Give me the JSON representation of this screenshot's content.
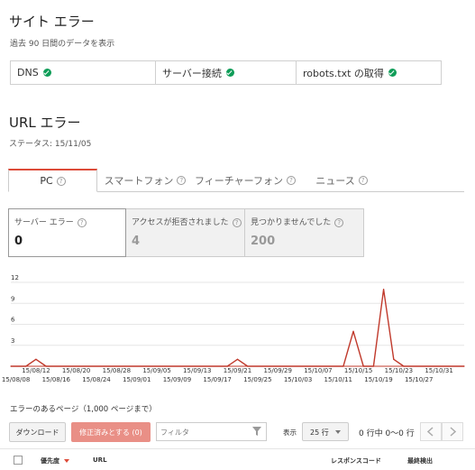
{
  "site_errors": {
    "title": "サイト エラー",
    "subtitle": "過去 90 日間のデータを表示",
    "items": [
      {
        "label": "DNS",
        "status": "ok"
      },
      {
        "label": "サーバー接続",
        "status": "ok"
      },
      {
        "label": "robots.txt の取得",
        "status": "ok"
      }
    ]
  },
  "url_errors": {
    "title": "URL エラー",
    "status": "ステータス: 15/11/05"
  },
  "tabs": [
    {
      "label": "PC",
      "active": true
    },
    {
      "label": "スマートフォン",
      "active": false
    },
    {
      "label": "フィーチャーフォン",
      "active": false
    },
    {
      "label": "ニュース",
      "active": false
    }
  ],
  "cards": [
    {
      "label": "サーバー エラー",
      "value": "0",
      "active": true
    },
    {
      "label": "アクセスが拒否されました",
      "value": "4",
      "active": false
    },
    {
      "label": "見つかりませんでした",
      "value": "200",
      "active": false
    }
  ],
  "chart_data": {
    "type": "line",
    "y_ticks": [
      "12",
      "9",
      "6",
      "3"
    ],
    "ylim": [
      0,
      12
    ],
    "x_ticks_top": [
      "15/08/12",
      "15/08/20",
      "15/08/28",
      "15/09/05",
      "15/09/13",
      "15/09/21",
      "15/09/29",
      "15/10/07",
      "15/10/15",
      "15/10/23",
      "15/10/31"
    ],
    "x_ticks_bottom": [
      "15/08/08",
      "15/08/16",
      "15/08/24",
      "15/09/01",
      "15/09/09",
      "15/09/17",
      "15/09/25",
      "15/10/03",
      "15/10/11",
      "15/10/19",
      "15/10/27"
    ],
    "series": [
      {
        "color": "#c0392b",
        "points": [
          [
            "15/08/07",
            0
          ],
          [
            "15/08/10",
            0
          ],
          [
            "15/08/12",
            1
          ],
          [
            "15/08/14",
            0
          ],
          [
            "15/09/19",
            0
          ],
          [
            "15/09/21",
            1
          ],
          [
            "15/09/23",
            0
          ],
          [
            "15/10/12",
            0
          ],
          [
            "15/10/14",
            5
          ],
          [
            "15/10/16",
            0
          ],
          [
            "15/10/18",
            0
          ],
          [
            "15/10/20",
            11
          ],
          [
            "15/10/22",
            1
          ],
          [
            "15/10/24",
            0
          ],
          [
            "15/11/05",
            0
          ]
        ]
      }
    ]
  },
  "pages_section": {
    "title": "エラーのあるページ（1,000 ページまで）",
    "download_label": "ダウンロード",
    "mark_fixed_label": "修正済みとする (0)",
    "filter_placeholder": "フィルタ",
    "show_label": "表示",
    "rows_label": "25 行",
    "range_label": "0 行中 0〜0 行"
  },
  "table": {
    "col_priority": "優先度",
    "col_url": "URL",
    "col_response": "レスポンスコード",
    "col_detected": "最終検出"
  }
}
